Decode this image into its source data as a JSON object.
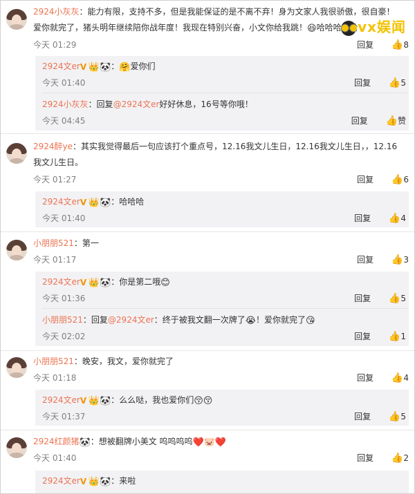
{
  "comments": [
    {
      "user": "2924小灰灰",
      "text": "：能力有限，支持不多，但是我能保证的是不离不弃！身为文家人我很骄傲，很自豪！",
      "text2": "爱你就完了，猪头明年继续陪你战年度！我现在特别兴奋，小文你给我跳！",
      "text2_tail": "哈哈哈哈哈",
      "time": "今天 01:29",
      "reply": "回复",
      "likes": "8",
      "subs": [
        {
          "user": "2924文er",
          "text": "：",
          "tail": "爱你们",
          "time": "今天 01:40",
          "reply": "回复",
          "likes": "5"
        },
        {
          "user": "2924小灰灰",
          "prefix": "：回复",
          "mention": "@2924文er",
          "text": "好好休息，16号等你哦！",
          "time": "今天 04:45",
          "reply": "回复",
          "likes": "赞"
        }
      ]
    },
    {
      "user": "2924醉ye",
      "text": "：其实我觉得最后一句应该打个重点号，12.16我文儿生日，12.16我文儿生日，，12.16",
      "text2": "我文儿生日。",
      "time": "今天 01:27",
      "reply": "回复",
      "likes": "6",
      "subs": [
        {
          "user": "2924文er",
          "text": "：哈哈哈",
          "time": "今天 01:40",
          "reply": "回复",
          "likes": "4"
        }
      ]
    },
    {
      "user": "小朋朋521",
      "text": "：第一",
      "time": "今天 01:17",
      "reply": "回复",
      "likes": "3",
      "subs": [
        {
          "user": "2924文er",
          "text": "：你是第二哦",
          "time": "今天 01:36",
          "reply": "回复",
          "likes": "5"
        },
        {
          "user": "小朋朋521",
          "prefix": "：回复",
          "mention": "@2924文er",
          "text": "：终于被我文翻一次牌了",
          "text_b": "！爱你就完了",
          "time": "今天 02:02",
          "reply": "回复",
          "likes": "1"
        }
      ]
    },
    {
      "user": "小朋朋521",
      "text": "：晚安，我文，爱你就完了",
      "time": "今天 01:18",
      "reply": "回复",
      "likes": "4",
      "subs": [
        {
          "user": "2924文er",
          "text": "：么么哒，我也爱你们",
          "time": "今天 01:37",
          "reply": "回复",
          "likes": "5"
        }
      ]
    },
    {
      "user": "2924红颜猪",
      "text": "：想被翻牌小美文 呜呜呜呜",
      "time": "今天 01:40",
      "reply": "回复",
      "likes": "2",
      "subs": [
        {
          "user": "2924文er",
          "text": "：来啦"
        }
      ]
    }
  ],
  "watermark": "vx娱闻",
  "icons": {
    "verified": "v-badge-icon",
    "thumb": "thumbs-up-icon"
  }
}
